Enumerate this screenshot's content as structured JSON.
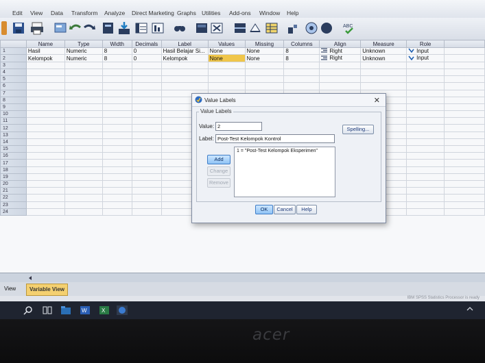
{
  "menu": [
    {
      "label": "Edit"
    },
    {
      "label": "View"
    },
    {
      "label": "Data"
    },
    {
      "label": "Transform"
    },
    {
      "label": "Analyze"
    },
    {
      "label": "Direct Marketing"
    },
    {
      "label": "Graphs"
    },
    {
      "label": "Utilities"
    },
    {
      "label": "Add-ons"
    },
    {
      "label": "Window"
    },
    {
      "label": "Help"
    }
  ],
  "grid": {
    "headers": [
      "Name",
      "Type",
      "Width",
      "Decimals",
      "Label",
      "Values",
      "Missing",
      "Columns",
      "Align",
      "Measure",
      "Role"
    ],
    "rows": [
      {
        "num": "1",
        "name": "Hasil",
        "type": "Numeric",
        "width": "8",
        "decimals": "0",
        "label": "Hasil Belajar Si...",
        "values": "None",
        "missing": "None",
        "columns": "8",
        "align": "Right",
        "measure": "Unknown",
        "role": "Input"
      },
      {
        "num": "2",
        "name": "Kelompok",
        "type": "Numeric",
        "width": "8",
        "decimals": "0",
        "label": "Kelompok",
        "values": "None",
        "missing": "None",
        "columns": "8",
        "align": "Right",
        "measure": "Unknown",
        "role": "Input"
      }
    ],
    "empty_row_numbers": [
      "3",
      "4",
      "5",
      "6",
      "7",
      "8",
      "9",
      "10",
      "11",
      "12",
      "13",
      "14",
      "15",
      "16",
      "17",
      "18",
      "19",
      "20",
      "21",
      "22",
      "23",
      "24"
    ]
  },
  "tabs": {
    "data_view": "View",
    "variable_view": "Variable View"
  },
  "status": {
    "processor": "IBM SPSS Statistics Processor is ready"
  },
  "dialog": {
    "title": "Value Labels",
    "group_label": "Value Labels",
    "value_label": "Value:",
    "value": "2",
    "label_label": "Label:",
    "label_value": "Post-Test Kelompok Kontrol",
    "spelling": "Spelling...",
    "list": [
      "1 = \"Post-Test Kelompok Eksperimen\""
    ],
    "add": "Add",
    "change": "Change",
    "remove": "Remove",
    "ok": "OK",
    "cancel": "Cancel",
    "help": "Help"
  },
  "brand": "acer",
  "colors": {
    "highlight": "#f0c64a",
    "accent": "#3d7cc7"
  }
}
